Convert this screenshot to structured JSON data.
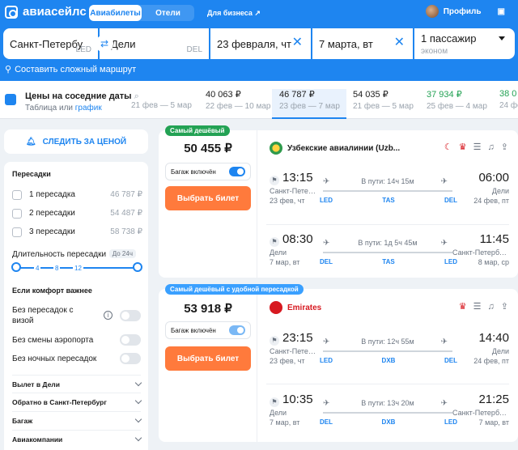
{
  "header": {
    "brand": "авиасейлс",
    "tabs": [
      "Авиабилеты",
      "Отели"
    ],
    "business": "Для бизнеса ↗",
    "profile": "Профиль"
  },
  "search": {
    "from_city": "Санкт-Петербу",
    "from_code": "LED",
    "to_city": "Дели",
    "to_code": "DEL",
    "depart": "23 февраля, чт",
    "return": "7 марта, вт",
    "passengers": "1 пассажир",
    "cabin": "эконом",
    "complex_route": "Составить сложный маршрут"
  },
  "nearby": {
    "title": "Цены на соседние даты",
    "sub_prefix": "Таблица или ",
    "sub_link": "график",
    "cells": [
      {
        "price": "",
        "range": "21 фев — 5 мар"
      },
      {
        "price": "40 063 ₽",
        "range": "22 фев — 10 мар"
      },
      {
        "price": "46 787 ₽",
        "range": "23 фев — 7 мар"
      },
      {
        "price": "54 035 ₽",
        "range": "21 фев — 5 мар"
      },
      {
        "price": "37 934 ₽",
        "range": "25 фев — 4 мар"
      },
      {
        "price": "38 0",
        "range": "24 фе"
      }
    ]
  },
  "sidebar": {
    "subscribe": "СЛЕДИТЬ ЗА ЦЕНОЙ",
    "stops_title": "Пересадки",
    "stops": [
      {
        "label": "1 пересадка",
        "price": "46 787 ₽"
      },
      {
        "label": "2 пересадки",
        "price": "54 487 ₽"
      },
      {
        "label": "3 пересадки",
        "price": "58 738 ₽"
      }
    ],
    "duration_title": "Длительность пересадки",
    "duration_badge": "До 24ч",
    "ticks": [
      "4",
      "8",
      "12"
    ],
    "comfort_title": "Если комфорт важнее",
    "toggles": [
      "Без пересадок с визой",
      "Без смены аэропорта",
      "Без ночных пересадок"
    ],
    "accordions": [
      "Вылет в Дели",
      "Обратно в Санкт-Петербург",
      "Багаж",
      "Авиакомпании"
    ]
  },
  "tickets": [
    {
      "badge": "Самый дешёвый",
      "price": "50 455 ₽",
      "baggage": "Багаж включён",
      "buy": "Выбрать билет",
      "airline": "Узбекские авиалинии (Uzb...",
      "segments": [
        {
          "dep_time": "13:15",
          "arr_time": "06:00",
          "dep_city": "Санкт-Петербург",
          "dep_date": "23 фев, чт",
          "arr_city": "Дели",
          "arr_date": "24 фев, пт",
          "duration": "В пути: 14ч 15м",
          "from": "LED",
          "via": "TAS",
          "to": "DEL"
        },
        {
          "dep_time": "08:30",
          "arr_time": "11:45",
          "dep_city": "Дели",
          "dep_date": "7 мар, вт",
          "arr_city": "Санкт-Петербург",
          "arr_date": "8 мар, ср",
          "duration": "В пути: 1д 5ч 45м",
          "from": "DEL",
          "via": "TAS",
          "to": "LED"
        }
      ]
    },
    {
      "badge": "Самый дешёвый с удобной пересадкой",
      "price": "53 918 ₽",
      "baggage": "Багаж включён",
      "buy": "Выбрать билет",
      "airline": "Emirates",
      "segments": [
        {
          "dep_time": "23:15",
          "arr_time": "14:40",
          "dep_city": "Санкт-Петербург",
          "dep_date": "23 фев, чт",
          "arr_city": "Дели",
          "arr_date": "24 фев, пт",
          "duration": "В пути: 12ч 55м",
          "from": "LED",
          "via": "DXB",
          "to": "DEL"
        },
        {
          "dep_time": "10:35",
          "arr_time": "21:25",
          "dep_city": "Дели",
          "dep_date": "7 мар, вт",
          "arr_city": "Санкт-Петербург",
          "arr_date": "7 мар, вт",
          "duration": "В пути: 13ч 20м",
          "from": "DEL",
          "via": "DXB",
          "to": "LED"
        }
      ]
    }
  ]
}
